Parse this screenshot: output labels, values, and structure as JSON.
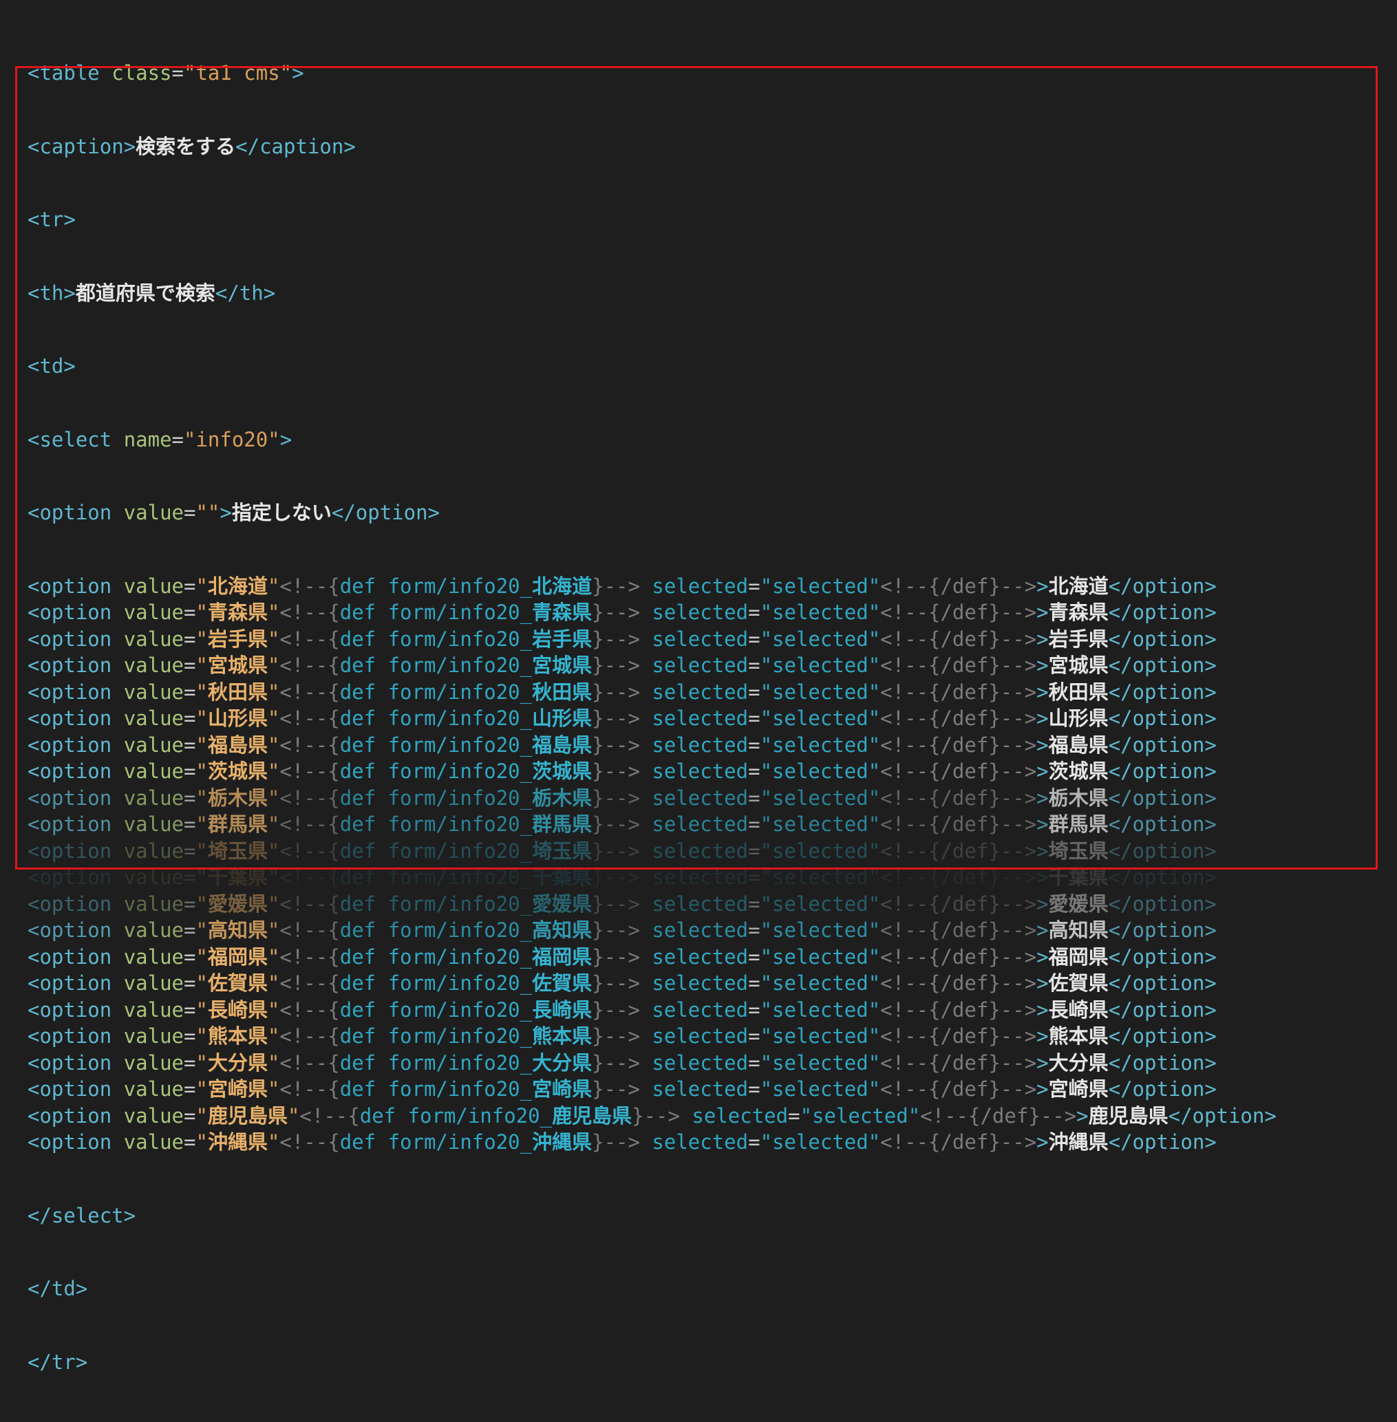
{
  "lines": {
    "table_open": {
      "tag_open": "<table ",
      "attr": "class",
      "eq": "=",
      "val": "\"ta1 cms\"",
      "tag_close": ">"
    },
    "caption": {
      "open": "<caption>",
      "text": "検索をする",
      "close": "</caption>"
    },
    "tr_open": "<tr>",
    "th": {
      "open": "<th>",
      "text": "都道府県で検索",
      "close": "</th>"
    },
    "td_open": "<td>",
    "select_open": {
      "tag_open": "<select ",
      "attr": "name",
      "eq": "=",
      "val": "\"info20\"",
      "tag_close": ">"
    },
    "option_none": {
      "tag_open": "<option ",
      "attr": "value",
      "eq": "=",
      "val": "\"\"",
      "tag_close": ">",
      "text": "指定しない",
      "close": "</option>"
    },
    "select_close": "</select>",
    "td_close": "</td>",
    "tr_close": "</tr>"
  },
  "option_template": {
    "tag_open": "<option ",
    "attr": "value",
    "eq": "=",
    "quote": "\"",
    "comment_open": "<!--{",
    "def_kw": "def form/info20_",
    "comment_close": "}-->",
    "selected_attr": " selected",
    "selected_val": "\"selected\"",
    "enddef": "<!--{/def}-->",
    "gt": ">",
    "close": "</option>"
  },
  "prefectures": [
    {
      "name": "北海道",
      "fade": ""
    },
    {
      "name": "青森県",
      "fade": ""
    },
    {
      "name": "岩手県",
      "fade": ""
    },
    {
      "name": "宮城県",
      "fade": ""
    },
    {
      "name": "秋田県",
      "fade": ""
    },
    {
      "name": "山形県",
      "fade": ""
    },
    {
      "name": "福島県",
      "fade": ""
    },
    {
      "name": "茨城県",
      "fade": ""
    },
    {
      "name": "栃木県",
      "fade": "fade1"
    },
    {
      "name": "群馬県",
      "fade": "fade1"
    },
    {
      "name": "埼玉県",
      "fade": "fade2"
    },
    {
      "name": "千葉県",
      "fade": "fade3"
    },
    {
      "name": "愛媛県",
      "fade": "fade4"
    },
    {
      "name": "高知県",
      "fade": "fade5"
    },
    {
      "name": "福岡県",
      "fade": ""
    },
    {
      "name": "佐賀県",
      "fade": ""
    },
    {
      "name": "長崎県",
      "fade": ""
    },
    {
      "name": "熊本県",
      "fade": ""
    },
    {
      "name": "大分県",
      "fade": ""
    },
    {
      "name": "宮崎県",
      "fade": ""
    },
    {
      "name": "鹿児島県",
      "fade": ""
    },
    {
      "name": "沖縄県",
      "fade": ""
    }
  ],
  "colors": {
    "background": "#1e1e1e",
    "highlight_border": "#e0161c"
  }
}
